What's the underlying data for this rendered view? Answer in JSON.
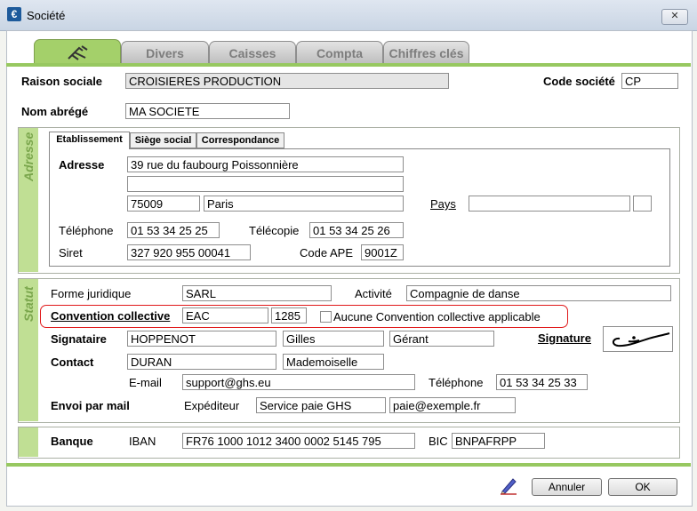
{
  "window": {
    "title": "Société",
    "app_icon_glyph": "€"
  },
  "tabs": [
    {
      "label": "",
      "icon": "beach-chair-icon"
    },
    {
      "label": "Divers"
    },
    {
      "label": "Caisses"
    },
    {
      "label": "Compta"
    },
    {
      "label": "Chiffres clés"
    }
  ],
  "header": {
    "raison_sociale_label": "Raison sociale",
    "raison_sociale_value": "CROISIERES PRODUCTION",
    "code_societe_label": "Code société",
    "code_societe_value": "CP",
    "nom_abrege_label": "Nom abrégé",
    "nom_abrege_value": "MA SOCIETE"
  },
  "adresse": {
    "section_label": "Adresse",
    "subtabs": [
      "Etablissement",
      "Siège social",
      "Correspondance"
    ],
    "adresse_label": "Adresse",
    "line1": "39 rue du faubourg Poissonnière",
    "line2": "",
    "code_postal": "75009",
    "ville": "Paris",
    "pays_label": "Pays",
    "pays_value": "",
    "pays_code": "",
    "telephone_label": "Téléphone",
    "telephone_value": "01 53 34 25 25",
    "telecopie_label": "Télécopie",
    "telecopie_value": "01 53 34 25 26",
    "siret_label": "Siret",
    "siret_value": "327 920 955 00041",
    "code_ape_label": "Code APE",
    "code_ape_value": "9001Z"
  },
  "statut": {
    "section_label": "Statut",
    "forme_juridique_label": "Forme juridique",
    "forme_juridique_value": "SARL",
    "activite_label": "Activité",
    "activite_value": "Compagnie de danse",
    "convention_label": "Convention collective",
    "convention_code": "EAC",
    "convention_number": "1285",
    "aucune_label": "Aucune Convention collective applicable",
    "signataire_label": "Signataire",
    "signataire_nom": "HOPPENOT",
    "signataire_prenom": "Gilles",
    "signataire_qualite": "Gérant",
    "signature_label": "Signature",
    "contact_label": "Contact",
    "contact_nom": "DURAN",
    "contact_civilite": "Mademoiselle",
    "email_label": "E-mail",
    "email_value": "support@ghs.eu",
    "contact_tel_label": "Téléphone",
    "contact_tel_value": "01 53 34 25 33",
    "envoi_label": "Envoi par mail",
    "expediteur_label": "Expéditeur",
    "expediteur_nom": "Service paie GHS",
    "expediteur_email": "paie@exemple.fr"
  },
  "banque": {
    "label": "Banque",
    "iban_label": "IBAN",
    "iban_value": "FR76 1000 1012 3400 0002 5145 795",
    "bic_label": "BIC",
    "bic_value": "BNPAFRPP"
  },
  "footer": {
    "cancel_label": "Annuler",
    "ok_label": "OK"
  },
  "colors": {
    "accent_green": "#97c860",
    "highlight_red": "#e0191a"
  }
}
